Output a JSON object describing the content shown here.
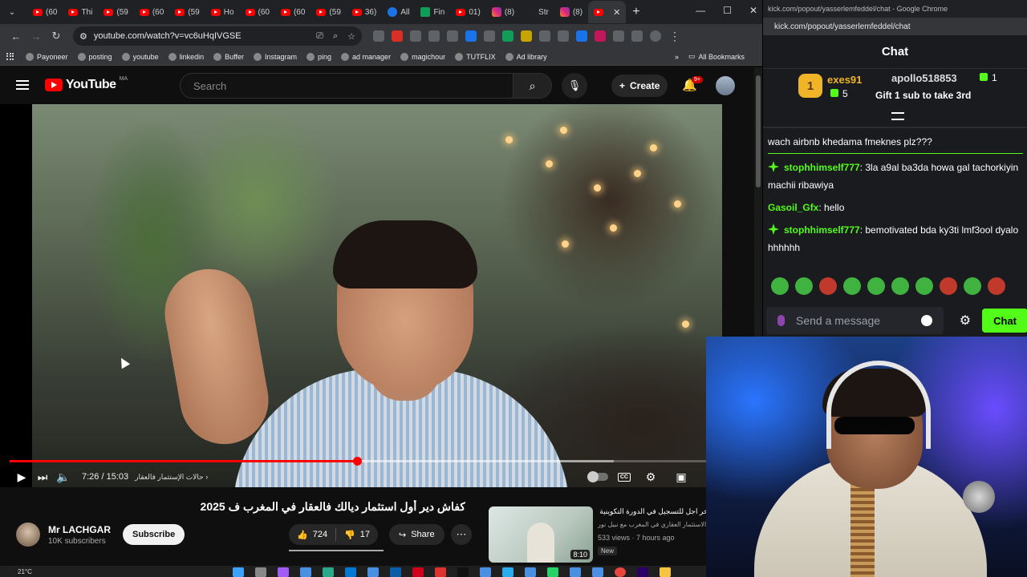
{
  "chrome": {
    "tabs": [
      {
        "label": "(60",
        "icon": "youtube-icon"
      },
      {
        "label": "Thi",
        "icon": "youtube-icon"
      },
      {
        "label": "(59",
        "icon": "youtube-icon"
      },
      {
        "label": "(60",
        "icon": "youtube-icon"
      },
      {
        "label": "(59",
        "icon": "youtube-icon"
      },
      {
        "label": "Ho",
        "icon": "youtube-icon"
      },
      {
        "label": "(60",
        "icon": "youtube-icon"
      },
      {
        "label": "(60",
        "icon": "youtube-icon"
      },
      {
        "label": "(59",
        "icon": "youtube-icon"
      },
      {
        "label": "36)",
        "icon": "youtube-icon"
      },
      {
        "label": "All",
        "icon": "blue-circle-icon"
      },
      {
        "label": "Fin",
        "icon": "green-icon"
      },
      {
        "label": "01)",
        "icon": "youtube-icon"
      },
      {
        "label": "(8)",
        "icon": "instagram-icon"
      },
      {
        "label": "Str",
        "icon": "kick-icon"
      },
      {
        "label": "(8)",
        "icon": "instagram-icon"
      },
      {
        "label": "",
        "icon": "youtube-icon",
        "active": true
      }
    ],
    "url": "youtube.com/watch?v=vc6uHqIVGSE",
    "bookmarks": [
      "Payoneer",
      "posting",
      "youtube",
      "linkedin",
      "Buffer",
      "Instagram",
      "ping",
      "ad manager",
      "magichour",
      "TUTFLIX",
      "Ad library"
    ],
    "all_bookmarks": "All Bookmarks"
  },
  "youtube": {
    "logo_text": "YouTube",
    "country_code": "MA",
    "search_placeholder": "Search",
    "create_label": "Create",
    "notif_count": "9+",
    "player": {
      "time": "7:26 / 15:03",
      "chapter": "حالات الإستثمار فالعقار",
      "progress": 0.494,
      "buffered": 0.86
    },
    "video_title": "كفاش دير أول استثمار ديالك فالعقار في المغرب ف 2025",
    "channel_name": "Mr LACHGAR",
    "subscribers": "10K subscribers",
    "subscribe_label": "Subscribe",
    "likes": "724",
    "dislikes": "17",
    "share_label": "Share",
    "recommendation": {
      "title": "آخر اجل للتسجيل في الدورة التكوينية التاسعة",
      "subtitle": "الاستثمار العقاري في المغرب مع نبيل نور",
      "meta": "533 views · 7 hours ago",
      "badge": "New",
      "duration": "8:10"
    }
  },
  "kick": {
    "titlebar": "kick.com/popout/yasserlemfeddel/chat - Google Chrome",
    "url": "kick.com/popout/yasserlemfeddel/chat",
    "header": "Chat",
    "leaderboard": {
      "rank1_name": "exes91",
      "rank1_count": "5",
      "rank1_badge": "1",
      "rank2_name": "apollo518853",
      "rank2_count": "1",
      "rank3_text": "Gift 1 sub to take 3rd"
    },
    "pinned_message": "wach airbnb khedama fmeknes plz???",
    "messages": [
      {
        "user": "stophhimself777",
        "text": "3la a9al ba3da howa gal tachorkiyin machii ribawiya"
      },
      {
        "user": "Gasoil_Gfx",
        "text": "hello"
      },
      {
        "user": "stophhimself777",
        "text": "bemotivated bda ky3ti lmf3ool dyalo hhhhhh"
      }
    ],
    "input_placeholder": "Send a message",
    "send_label": "Chat"
  },
  "taskbar": {
    "weather": "21°C"
  },
  "colors": {
    "kick_green": "#53fc18",
    "yt_red": "#ff0000"
  }
}
